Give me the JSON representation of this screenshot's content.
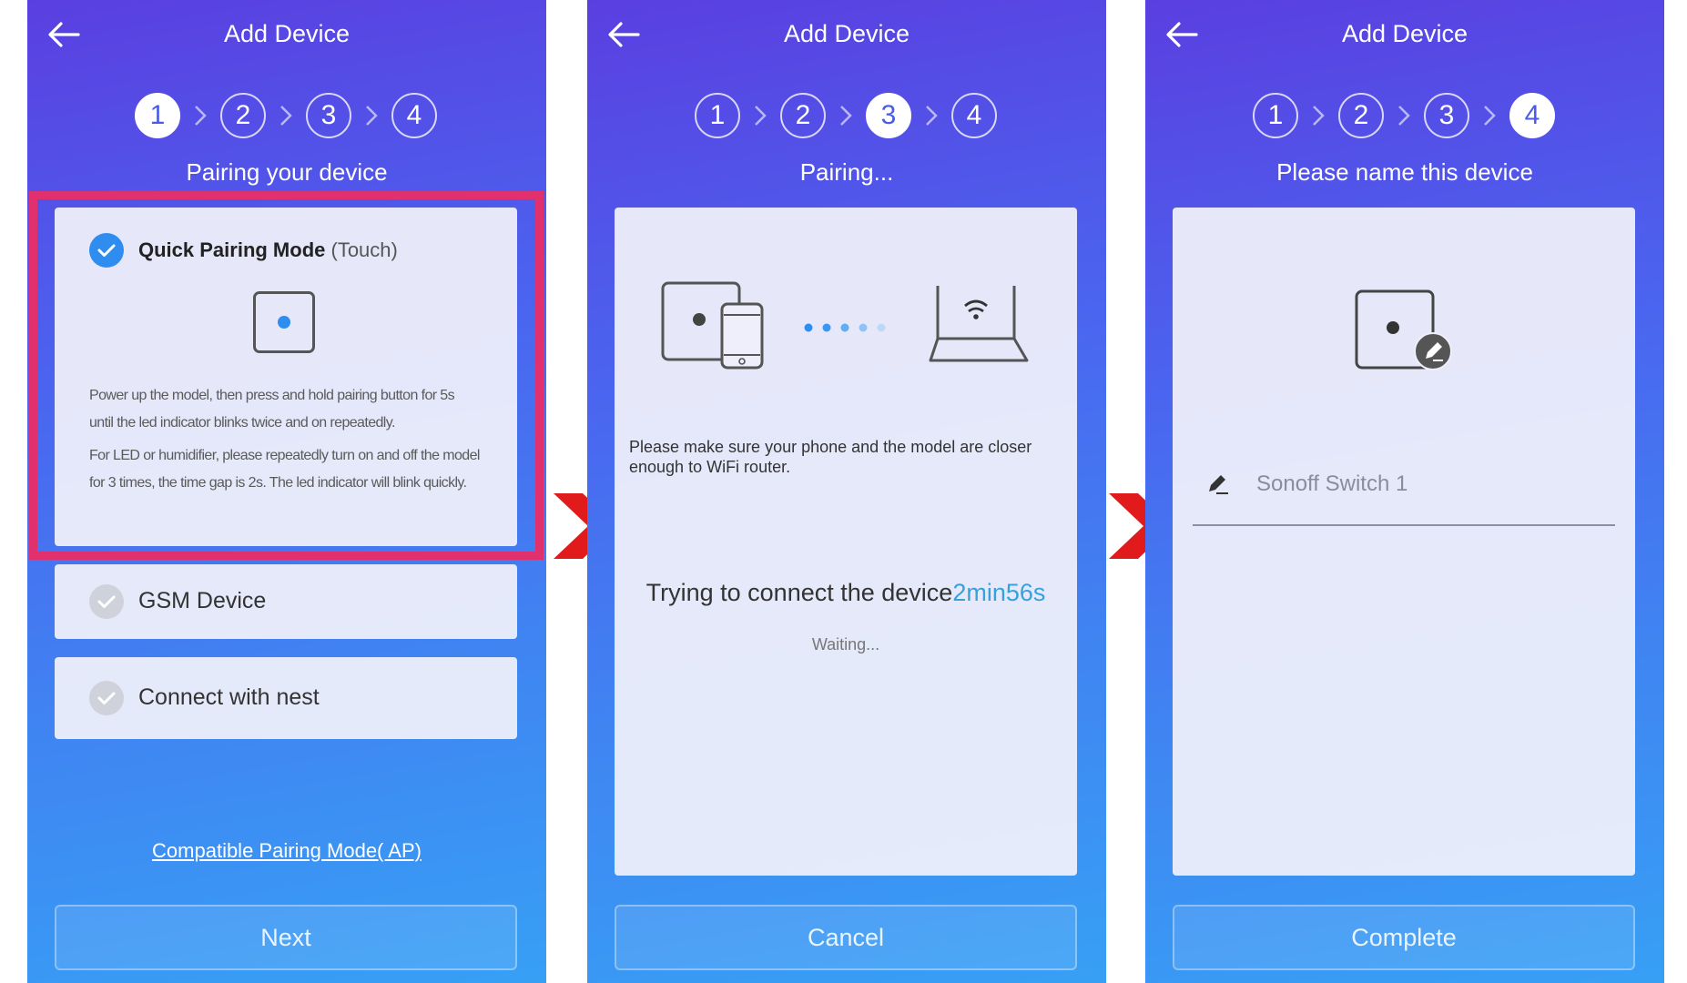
{
  "colors": {
    "accent_blue": "#2f8df0",
    "highlight": "#e0306e",
    "arrow_red": "#e11b1b",
    "timer": "#35a2db"
  },
  "screen1": {
    "header": {
      "back_icon": "arrow-left-icon",
      "title": "Add Device"
    },
    "steps": [
      "1",
      "2",
      "3",
      "4"
    ],
    "active_step": 1,
    "subtitle": "Pairing your device",
    "quick_mode": {
      "label": "Quick Pairing Mode",
      "label_suffix": "(Touch)",
      "checked": true,
      "instructions_1": "Power up the model, then press and hold pairing button for 5s until the led indicator blinks twice and on repeatedly.",
      "instructions_2": "For LED or humidifier, please repeatedly turn on and off the model for 3 times, the time gap is 2s. The led indicator will blink quickly."
    },
    "options": [
      {
        "label": "GSM Device",
        "checked": false
      },
      {
        "label": "Connect with nest",
        "checked": false
      }
    ],
    "link": "Compatible Pairing Mode( AP)",
    "button": "Next"
  },
  "screen2": {
    "header": {
      "back_icon": "arrow-left-icon",
      "title": "Add Device"
    },
    "steps": [
      "1",
      "2",
      "3",
      "4"
    ],
    "active_step": 3,
    "subtitle": "Pairing...",
    "hint": "Please make sure your phone and the model are closer enough to WiFi router.",
    "status": "Trying to connect the device",
    "timer": "2min56s",
    "waiting": "Waiting...",
    "button": "Cancel"
  },
  "screen3": {
    "header": {
      "back_icon": "arrow-left-icon",
      "title": "Add Device"
    },
    "steps": [
      "1",
      "2",
      "3",
      "4"
    ],
    "active_step": 4,
    "subtitle": "Please name this device",
    "name_value": "Sonoff Switch 1",
    "button": "Complete"
  }
}
